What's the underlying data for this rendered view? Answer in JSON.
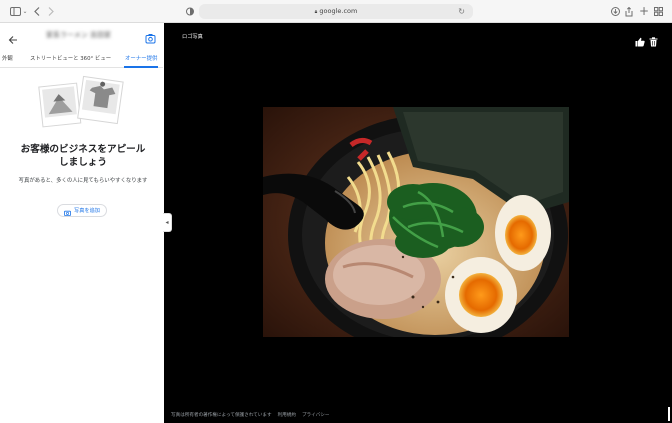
{
  "browser": {
    "url": "google.com",
    "icons": [
      "sidebar-icon",
      "chevron-down-icon",
      "back-icon",
      "forward-icon",
      "shield-icon",
      "lock-icon",
      "reload-icon",
      "download-icon",
      "share-icon",
      "new-tab-icon",
      "tab-overview-icon"
    ]
  },
  "panel": {
    "title": "家系ラーメン 吉田家",
    "tabs": [
      {
        "label": "外観",
        "active": false
      },
      {
        "label": "ストリートビューと 360° ビュー",
        "active": false
      },
      {
        "label": "オーナー提供",
        "active": true
      }
    ],
    "headline_line1": "お客様のビジネスをアピール",
    "headline_line2": "しましょう",
    "subtext": "写真があると、多くの人に見てもらいやすくなります",
    "add_photo_label": "写真を追加",
    "accent_color": "#1a73e8"
  },
  "viewer": {
    "title": "ロゴ写真",
    "footer_rights": "写真は所有者の著作権によって保護されています",
    "footer_terms": "利用規約",
    "footer_privacy": "プライバシー",
    "photo_alt": "ramen-bowl-photo"
  }
}
